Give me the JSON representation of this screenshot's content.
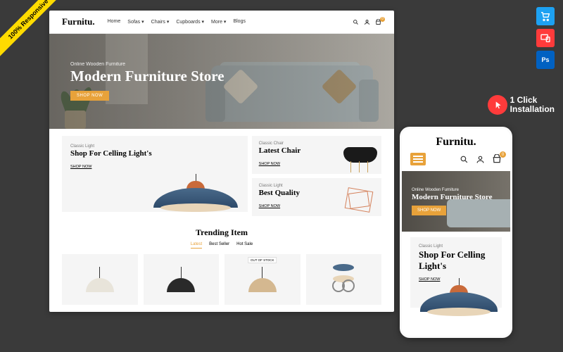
{
  "ribbon": "100% Responsive",
  "install": {
    "line1": "1 Click",
    "line2": "Installation"
  },
  "desktop": {
    "logo": "Furnitu.",
    "nav": [
      "Home",
      "Sofas ▾",
      "Chairs ▾",
      "Cupboards ▾",
      "More ▾",
      "Blogs"
    ],
    "cart_count": "0",
    "hero": {
      "pre": "Online Wooden Furniture",
      "title": "Modern Furniture Store",
      "cta": "SHOP NOW"
    },
    "promo_large": {
      "eyebrow": "Classic Light",
      "title": "Shop For Celling Light's",
      "link": "SHOP NOW"
    },
    "promo_small": [
      {
        "eyebrow": "Classic Chair",
        "title": "Latest Chair",
        "link": "SHOP NOW"
      },
      {
        "eyebrow": "Classic Light",
        "title": "Best Quality",
        "link": "SHOP NOW"
      }
    ],
    "trending": {
      "title": "Trending Item",
      "tabs": [
        "Latest",
        "Best Seller",
        "Hot Sale"
      ],
      "stock_badge": "OUT OF STOCK"
    }
  },
  "mobile": {
    "logo": "Furnitu.",
    "cart_count": "0",
    "hero": {
      "pre": "Online Wooden Furniture",
      "title": "Modern Furniture Store",
      "cta": "SHOP NOW"
    },
    "promo": {
      "eyebrow": "Classic Light",
      "title": "Shop For Celling Light's",
      "link": "SHOP NOW"
    }
  }
}
